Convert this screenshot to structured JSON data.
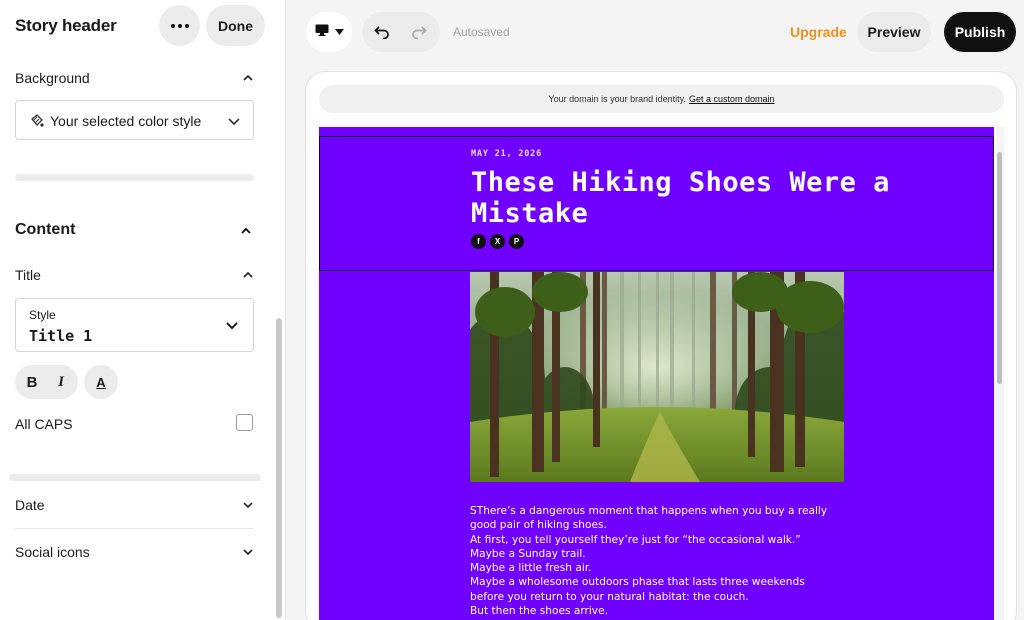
{
  "panel": {
    "title": "Story header",
    "done_label": "Done",
    "background": {
      "label": "Background",
      "color_style": "Your selected color style"
    },
    "content": {
      "label": "Content",
      "title_section": {
        "label": "Title",
        "style_label": "Style",
        "style_value": "Title 1",
        "bold": "B",
        "italic": "I",
        "color": "A",
        "all_caps_label": "All CAPS"
      },
      "date_label": "Date",
      "social_icons_label": "Social icons"
    }
  },
  "toolbar": {
    "autosaved": "Autosaved",
    "upgrade": "Upgrade",
    "preview": "Preview",
    "publish": "Publish"
  },
  "preview": {
    "domain_notice": "Your domain is your brand identity.",
    "domain_link": "Get a custom domain",
    "story": {
      "date": "MAY 21, 2026",
      "title": "These Hiking Shoes Were a Mistake",
      "social": [
        "f",
        "X",
        "P"
      ],
      "body": "SThere’s a dangerous moment that happens when you buy a really\ngood pair of hiking shoes.\nAt first, you tell yourself they’re just for “the occasional walk.”\nMaybe a Sunday trail.\n Maybe a little fresh air.\n Maybe a wholesome outdoors phase that lasts three weekends\nbefore you return to your natural habitat: the couch.\nBut then the shoes arrive."
    }
  },
  "colors": {
    "story_background": "#7000ff",
    "upgrade": "#f0901b",
    "publish_bg": "#111111"
  }
}
